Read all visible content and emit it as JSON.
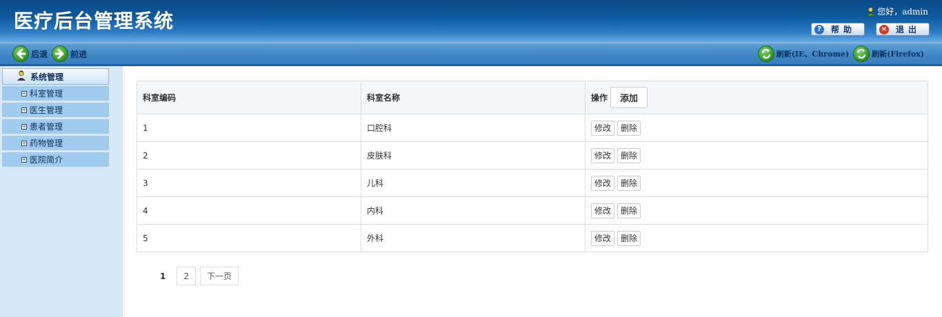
{
  "header": {
    "title": "医疗后台管理系统",
    "greeting": "您好，admin",
    "help_label": "帮助",
    "logout_label": "退出"
  },
  "toolbar": {
    "back_label": "后退",
    "forward_label": "前进",
    "refresh_ie_label": "刷新(IE、Chrome)",
    "refresh_ff_label": "刷新(Firefox)"
  },
  "sidebar": {
    "section_title": "系统管理",
    "items": [
      {
        "label": "科室管理"
      },
      {
        "label": "医生管理"
      },
      {
        "label": "患者管理"
      },
      {
        "label": "药物管理"
      },
      {
        "label": "医院简介"
      }
    ]
  },
  "table": {
    "headers": [
      "科室编码",
      "科室名称",
      "操作"
    ],
    "add_label": "添加",
    "edit_label": "修改",
    "delete_label": "删除",
    "rows": [
      {
        "code": "1",
        "name": "口腔科"
      },
      {
        "code": "2",
        "name": "皮肤科"
      },
      {
        "code": "3",
        "name": "儿科"
      },
      {
        "code": "4",
        "name": "内科"
      },
      {
        "code": "5",
        "name": "外科"
      }
    ]
  },
  "pagination": {
    "current": "1",
    "page2": "2",
    "next_label": "下一页"
  },
  "colors": {
    "header_dark": "#0a4a86",
    "toolbar_blue": "#3f86c6",
    "sidebar_bg": "#d7e9f8",
    "sidebar_item": "#9ecbee"
  }
}
